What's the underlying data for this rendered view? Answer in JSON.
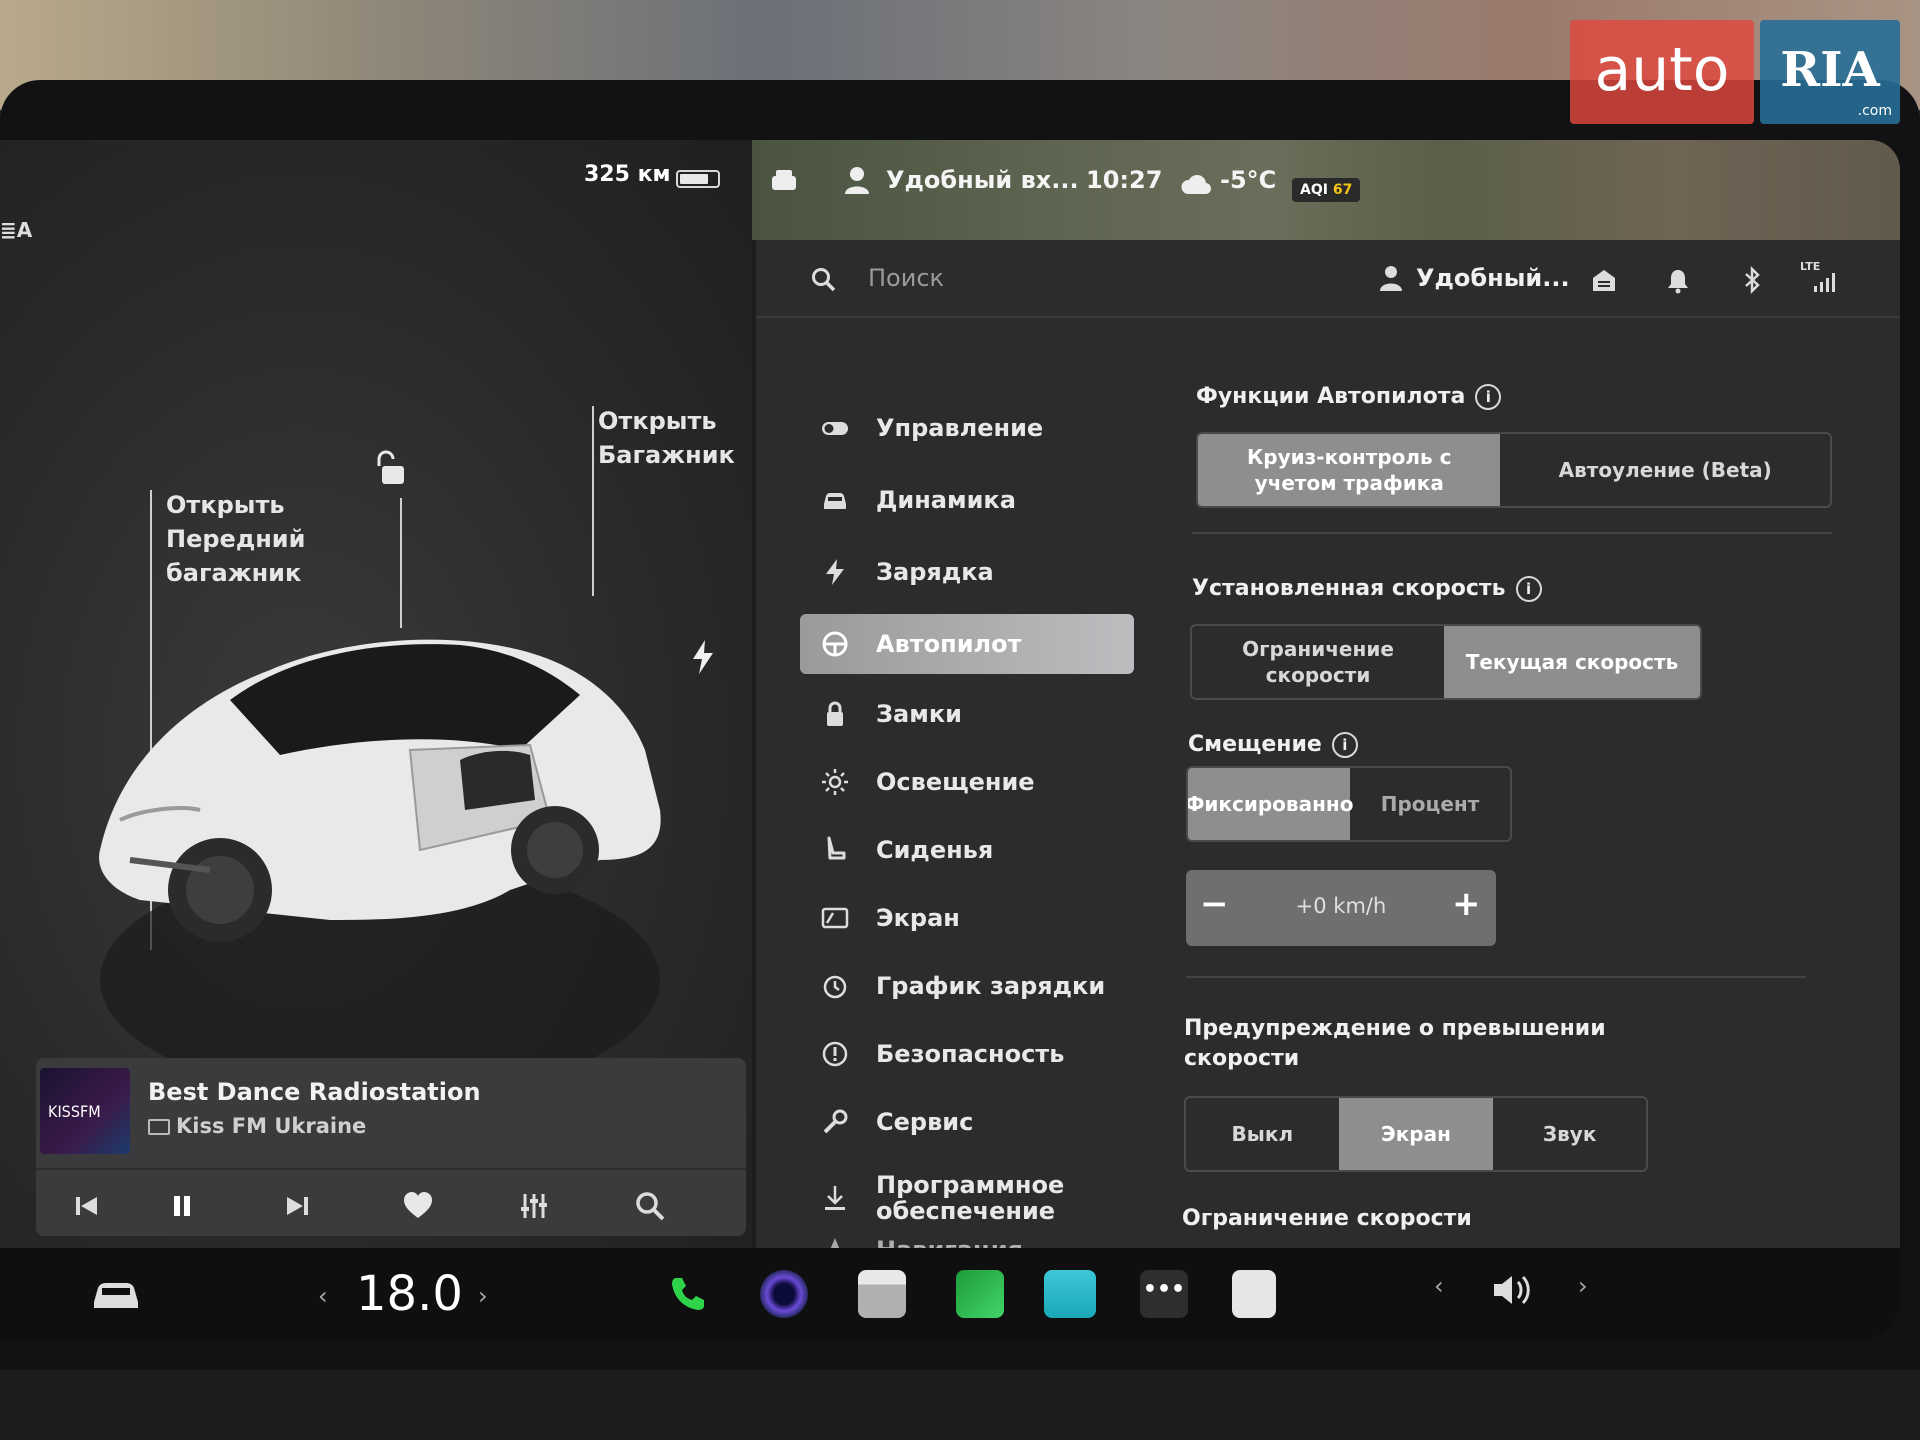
{
  "watermark": {
    "brand_left": "auto",
    "brand_right": "RIA",
    "domain": ".com"
  },
  "vehicle": {
    "range": "325 км",
    "auto_headlights_label": "≣A",
    "front_trunk_label": "Открыть\nПередний\nбагажник",
    "trunk_label": "Открыть\nБагажник"
  },
  "media": {
    "art_text": "KISSFM",
    "title": "Best Dance Radiostation",
    "station": "Kiss FM Ukraine",
    "controls": [
      "previous-icon",
      "pause-icon",
      "next-icon",
      "heart-icon",
      "equalizer-icon",
      "search-icon"
    ]
  },
  "status_bar": {
    "profile": "Удобный вх...",
    "time": "10:27",
    "temperature": "-5°C",
    "aqi_label": "AQI",
    "aqi_value": "67"
  },
  "settings_header": {
    "search_placeholder": "Поиск",
    "profile_name": "Удобный...",
    "lte_label": "LTE"
  },
  "menu": {
    "items": [
      {
        "label": "Управление",
        "icon": "toggle-icon"
      },
      {
        "label": "Динамика",
        "icon": "car-icon"
      },
      {
        "label": "Зарядка",
        "icon": "bolt-icon"
      },
      {
        "label": "Автопилот",
        "icon": "steering-wheel-icon",
        "active": true
      },
      {
        "label": "Замки",
        "icon": "lock-icon"
      },
      {
        "label": "Освещение",
        "icon": "sun-icon"
      },
      {
        "label": "Сиденья",
        "icon": "seat-icon"
      },
      {
        "label": "Экран",
        "icon": "display-icon"
      },
      {
        "label": "График зарядки",
        "icon": "clock-icon"
      },
      {
        "label": "Безопасность",
        "icon": "info-circle-icon"
      },
      {
        "label": "Сервис",
        "icon": "wrench-icon"
      },
      {
        "label": "Программное обеспечение",
        "icon": "download-icon"
      },
      {
        "label": "Навигация",
        "icon": "navigation-icon"
      }
    ]
  },
  "autopilot": {
    "features_title": "Функции Автопилота",
    "features_options": [
      "Круиз-контроль с учетом трафика",
      "Автоуление (Beta)"
    ],
    "features_selected": 0,
    "set_speed_title": "Установленная скорость",
    "set_speed_options": [
      "Ограничение скорости",
      "Текущая скорость"
    ],
    "set_speed_selected": 1,
    "offset_title": "Смещение",
    "offset_options": [
      "Фиксированно",
      "Процент"
    ],
    "offset_selected": 0,
    "offset_value": "+0 km/h",
    "warning_title": "Предупреждение о превышении\nскорости",
    "warning_options": [
      "Выкл",
      "Экран",
      "Звук"
    ],
    "warning_selected": 1,
    "speed_limit_title": "Ограничение скорости"
  },
  "dock": {
    "temperature": "18.0",
    "apps": [
      "phone-icon",
      "camera-icon",
      "calendar-icon",
      "stocks-icon",
      "toybox-icon",
      "more-icon",
      "notes-icon"
    ]
  },
  "colors": {
    "accent_selected": "#8e8e90",
    "background": "#2c2c2e",
    "phone_green": "#2fd34a",
    "watermark_red": "#e0483e",
    "watermark_blue": "#286e96"
  }
}
